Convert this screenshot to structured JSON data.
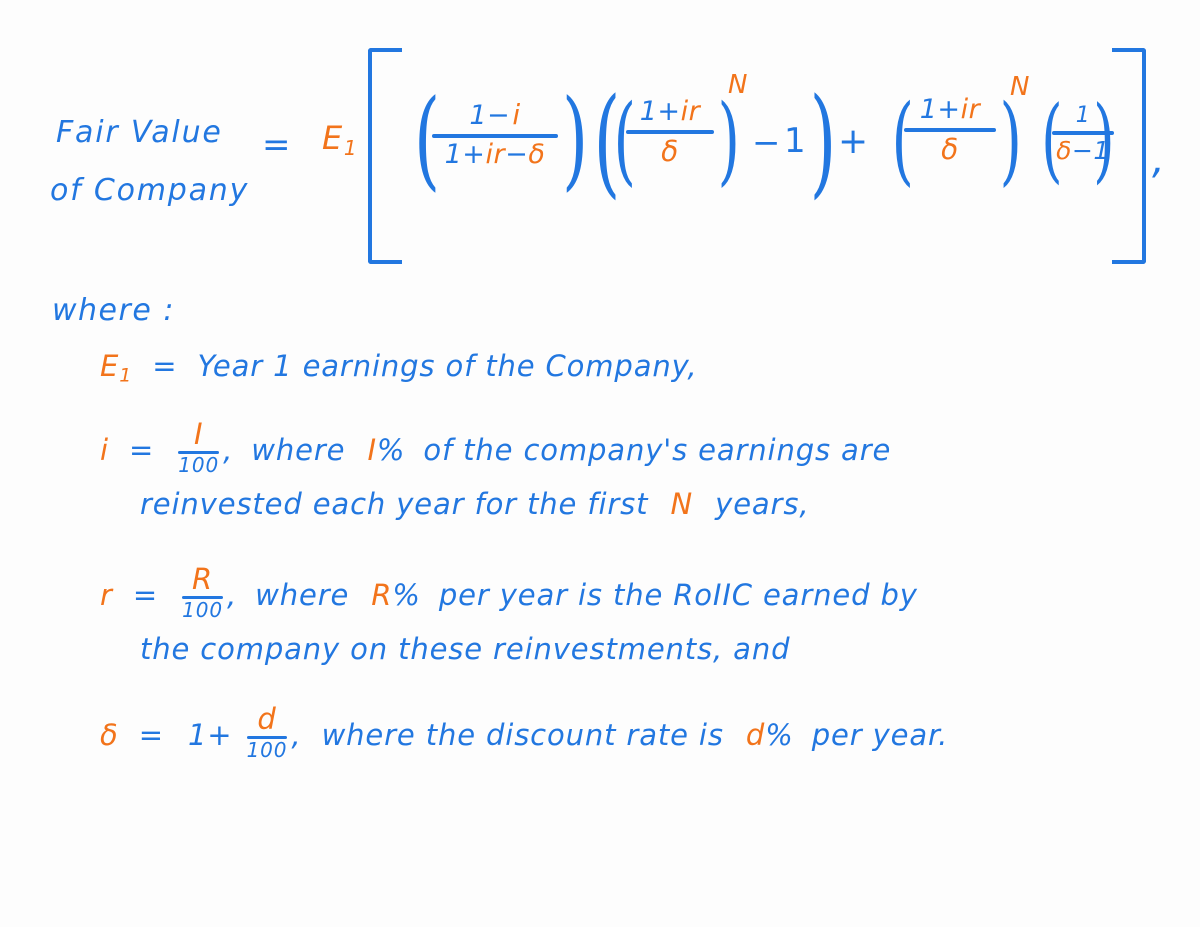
{
  "colors": {
    "ink_blue": "#2277e0",
    "ink_orange": "#f2741b",
    "background": "#fdfdfd"
  },
  "formula": {
    "lhs_line1": "Fair  Value",
    "lhs_line2": "of  Company",
    "equals": "=",
    "leading_factor": "E",
    "leading_factor_sub": "1",
    "bracket_open": "[",
    "bracket_close": "]",
    "trailing_comma": ",",
    "group1": {
      "paren_open": "(",
      "paren_close": ")",
      "numerator_one": "1",
      "numerator_minus": "−",
      "numerator_var": "i",
      "denominator_one": "1+",
      "denominator_ir": "ir",
      "denominator_minus": "−",
      "denominator_delta": "δ"
    },
    "group2": {
      "outer_paren_open": "(",
      "outer_paren_close": ")",
      "inner_paren_open": "(",
      "inner_paren_close": ")",
      "numerator_one": "1+",
      "numerator_ir": "ir",
      "denominator_delta": "δ",
      "exponent": "N",
      "minus": "−",
      "minus_one": "1"
    },
    "plus": "+",
    "group3": {
      "paren_open": "(",
      "paren_close": ")",
      "numerator_one": "1+",
      "numerator_ir": "ir",
      "denominator_delta": "δ",
      "exponent": "N"
    },
    "group4": {
      "paren_open": "(",
      "paren_close": ")",
      "numerator_one": "1",
      "denominator_delta": "δ",
      "denominator_minus": "−",
      "denominator_one": "1"
    }
  },
  "where": {
    "label": "where :",
    "definitions": [
      {
        "id": "E1",
        "symbol": "E",
        "symbol_sub": "1",
        "equals": "=",
        "text": "Year  1  earnings  of  the  Company,"
      },
      {
        "id": "i",
        "symbol": "i",
        "equals": "=",
        "frac_num": "I",
        "frac_den": "100",
        "comma": ",",
        "text_a": "where",
        "highlight": "I",
        "percent": "%",
        "text_b": "of  the  company's  earnings  are",
        "text_continued_a": "reinvested  each  year  for  the  first",
        "text_continued_highlight": "N",
        "text_continued_b": "years,"
      },
      {
        "id": "r",
        "symbol": "r",
        "equals": "=",
        "frac_num": "R",
        "frac_den": "100",
        "comma": ",",
        "text_a": "where",
        "highlight": "R",
        "percent": "%",
        "text_b": "per  year  is  the  RoIIC  earned  by",
        "text_continued": "the  company  on  these  reinvestments,  and"
      },
      {
        "id": "delta",
        "symbol": "δ",
        "equals": "=",
        "lead": "1+",
        "frac_num": "d",
        "frac_den": "100",
        "comma": ",",
        "text_a": "where  the  discount  rate  is",
        "highlight": "d",
        "percent": "%",
        "text_b": "per  year."
      }
    ]
  }
}
